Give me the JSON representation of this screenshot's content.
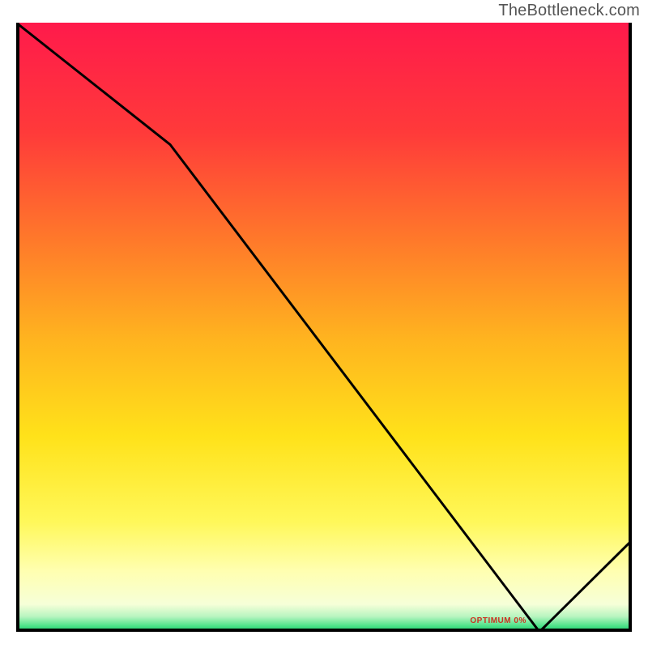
{
  "attribution": "TheBottleneck.com",
  "chart_data": {
    "type": "line",
    "title": "",
    "xlabel": "",
    "ylabel": "",
    "ylim": [
      0,
      100
    ],
    "xlim": [
      0,
      100
    ],
    "x": [
      0,
      25,
      85,
      100
    ],
    "values": [
      100,
      80,
      0,
      15
    ],
    "gradient_stops": [
      {
        "pos": 0.0,
        "color": "#ff1a4b"
      },
      {
        "pos": 0.18,
        "color": "#ff3a3a"
      },
      {
        "pos": 0.36,
        "color": "#ff7a2a"
      },
      {
        "pos": 0.52,
        "color": "#ffb41f"
      },
      {
        "pos": 0.68,
        "color": "#ffe21a"
      },
      {
        "pos": 0.82,
        "color": "#fff85a"
      },
      {
        "pos": 0.9,
        "color": "#ffffb0"
      },
      {
        "pos": 0.955,
        "color": "#f6ffd8"
      },
      {
        "pos": 0.975,
        "color": "#b8f5c0"
      },
      {
        "pos": 0.99,
        "color": "#4fe28a"
      },
      {
        "pos": 1.0,
        "color": "#18cc6a"
      }
    ],
    "annotations": [
      {
        "x": 79,
        "y": 1.5,
        "text": "OPTIMUM 0%"
      }
    ]
  }
}
